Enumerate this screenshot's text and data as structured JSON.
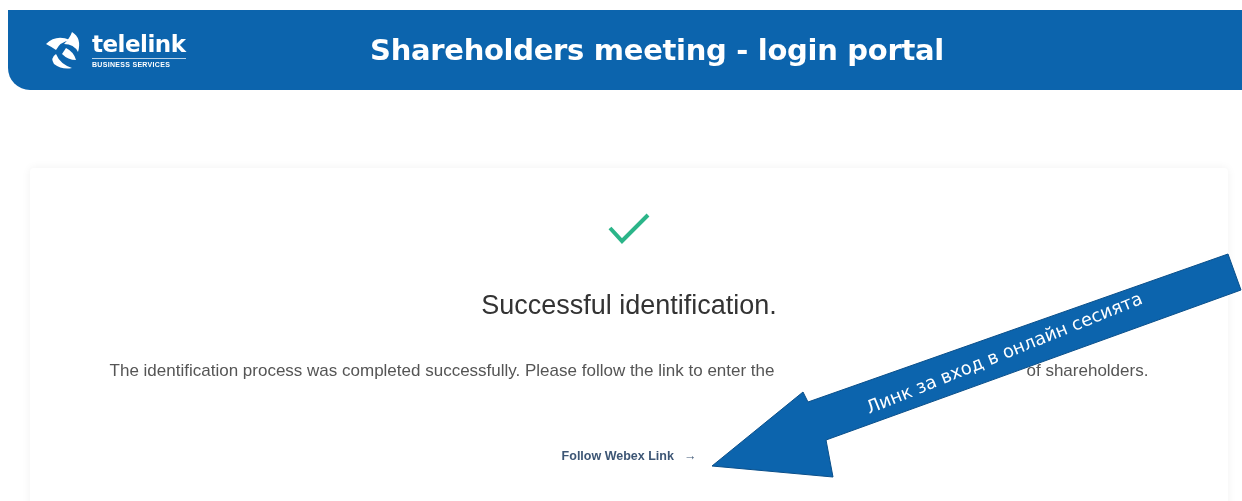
{
  "header": {
    "logo": {
      "name": "telelink",
      "tagline": "BUSINESS SERVICES"
    },
    "title": "Shareholders meeting - login portal"
  },
  "result": {
    "heading": "Successful identification.",
    "message_parts": [
      "The identification process was completed successfully. Please follow the link to enter the",
      "of shareholders."
    ],
    "link": {
      "label": "Follow Webex Link",
      "icon": "→"
    }
  },
  "annotation": {
    "text": "Линк за вход в онлайн сесията"
  }
}
